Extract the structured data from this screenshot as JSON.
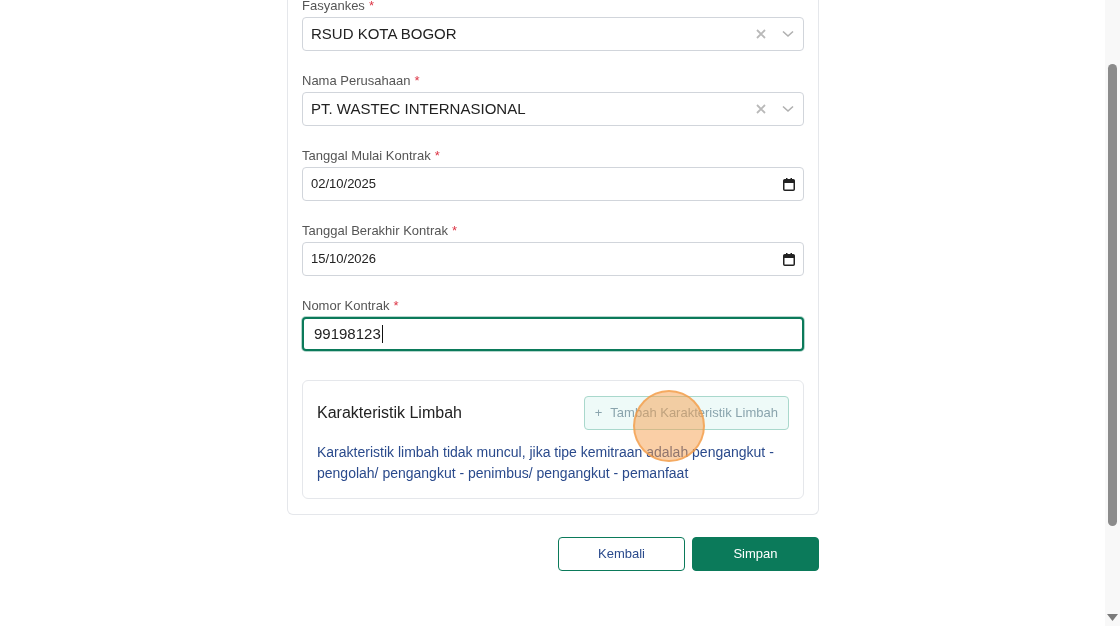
{
  "fields": [
    {
      "kind": "select",
      "label": "Fasyankes",
      "required": true,
      "value": "RSUD KOTA BOGOR",
      "clearable": true,
      "focused": false
    },
    {
      "kind": "select",
      "label": "Nama Perusahaan",
      "required": true,
      "value": "PT. WASTEC INTERNASIONAL",
      "clearable": true,
      "focused": false
    },
    {
      "kind": "date",
      "label": "Tanggal Mulai Kontrak",
      "required": true,
      "value": "02/10/2025",
      "focused": false
    },
    {
      "kind": "date",
      "label": "Tanggal Berakhir Kontrak",
      "required": true,
      "value": "15/10/2026",
      "focused": false
    },
    {
      "kind": "text",
      "label": "Nomor Kontrak",
      "required": true,
      "value": "99198123",
      "focused": true
    }
  ],
  "required_mark": "*",
  "karakteristik": {
    "title": "Karakteristik Limbah",
    "add_button": {
      "icon": "+",
      "label": "Tambah Karakteristik Limbah",
      "disabled": true
    },
    "note": "Karakteristik limbah tidak muncul, jika tipe kemitraan adalah pengangkut - pengolah/ pengangkut - penimbus/ pengangkut - pemanfaat"
  },
  "buttons": [
    {
      "kind": "secondary",
      "label": "Kembali"
    },
    {
      "kind": "primary",
      "label": "Simpan"
    }
  ]
}
